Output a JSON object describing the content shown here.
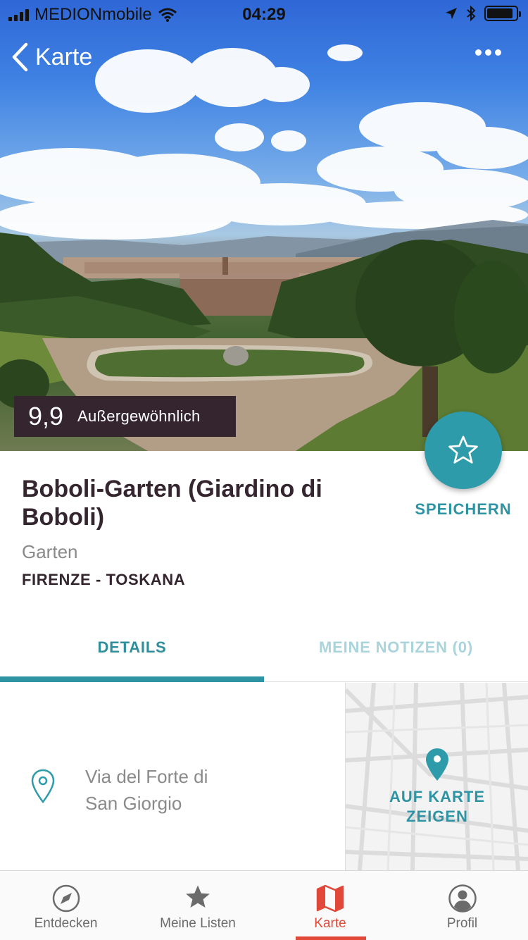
{
  "status_bar": {
    "carrier": "MEDIONmobile",
    "time": "04:29",
    "battery_level": 0.9
  },
  "nav": {
    "back_label": "Karte",
    "back_icon": "chevron-left-icon",
    "more_icon": "more-dots-icon"
  },
  "rating": {
    "score": "9,9",
    "label": "Außergewöhnlich"
  },
  "save": {
    "icon": "star-outline-icon",
    "label": "SPEICHERN"
  },
  "place": {
    "title": "Boboli-Garten (Giardino di Boboli)",
    "category": "Garten",
    "location": "FIRENZE - TOSKANA"
  },
  "tabs": [
    {
      "label": "DETAILS",
      "active": true
    },
    {
      "label": "MEINE NOTIZEN (0)",
      "active": false
    }
  ],
  "address": {
    "line1": "Via del Forte di",
    "line2": "San Giorgio",
    "icon": "location-pin-icon"
  },
  "map_link": {
    "line1": "AUF KARTE",
    "line2": "ZEIGEN"
  },
  "bottom_nav": [
    {
      "label": "Entdecken",
      "icon": "compass-icon",
      "active": false
    },
    {
      "label": "Meine Listen",
      "icon": "star-icon",
      "active": false
    },
    {
      "label": "Karte",
      "icon": "map-icon",
      "active": true
    },
    {
      "label": "Profil",
      "icon": "profile-icon",
      "active": false
    }
  ],
  "colors": {
    "accent": "#2e9bab",
    "active_nav": "#e1483a",
    "dark": "#35252f"
  }
}
